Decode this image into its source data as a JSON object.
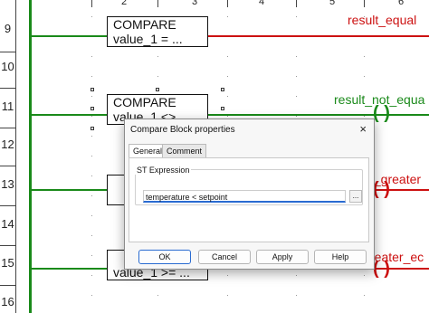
{
  "columns": [
    "2",
    "3",
    "4",
    "5",
    "6"
  ],
  "rows": [
    "9",
    "10",
    "11",
    "12",
    "13",
    "14",
    "15",
    "16"
  ],
  "blocks": [
    {
      "title": "COMPARE",
      "expr": "value_1 = ..."
    },
    {
      "title": "COMPARE",
      "expr": "value_1 <>"
    },
    {
      "title": "",
      "expr": "value_1 >= ..."
    }
  ],
  "outputs": [
    {
      "label": "result_equal",
      "color": "#cc1111"
    },
    {
      "label": "result_not_equa",
      "color": "#1a8a1a"
    },
    {
      "label": "t_greater",
      "color": "#cc1111"
    },
    {
      "label": "reater_ec",
      "color": "#cc1111"
    }
  ],
  "coil_glyph": "( )",
  "dialog": {
    "title": "Compare Block properties",
    "close_glyph": "×",
    "tabs": [
      "General",
      "Comment"
    ],
    "active_tab": "General",
    "group_label": "ST Expression",
    "expression": "temperature < setpoint",
    "browse_label": "...",
    "buttons": {
      "ok": "OK",
      "cancel": "Cancel",
      "apply": "Apply",
      "help": "Help"
    }
  },
  "colors": {
    "rail": "#1a8a1a",
    "energized": "#1a8a1a",
    "deenergized": "#cc1111",
    "focus": "#2a6bd1"
  }
}
